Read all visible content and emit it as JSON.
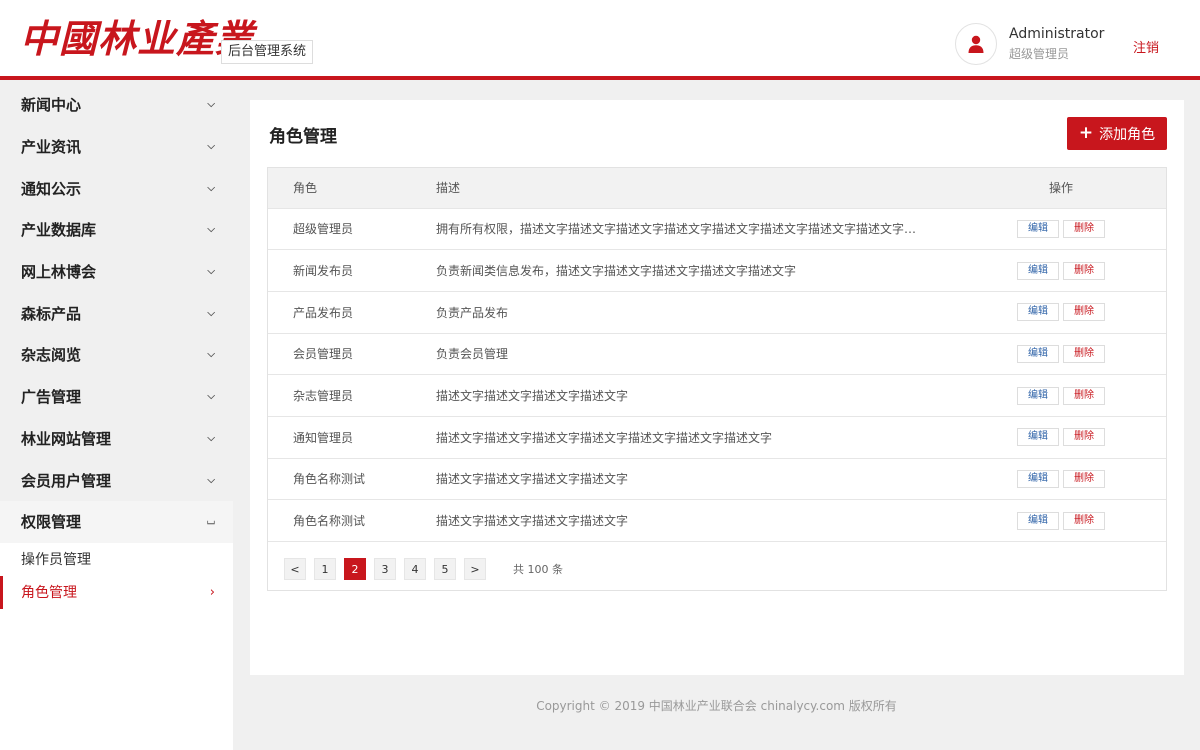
{
  "header": {
    "logo_text": "中國林业產業",
    "system_name": "后台管理系统",
    "user": {
      "name": "Administrator",
      "role": "超级管理员"
    },
    "logout_label": "注销"
  },
  "sidebar": {
    "items": [
      {
        "label": "新闻中心",
        "icon": "chevron-down-icon"
      },
      {
        "label": "产业资讯",
        "icon": "chevron-down-icon"
      },
      {
        "label": "通知公示",
        "icon": "chevron-down-icon"
      },
      {
        "label": "产业数据库",
        "icon": "chevron-down-icon"
      },
      {
        "label": "网上林博会",
        "icon": "chevron-down-icon"
      },
      {
        "label": "森标产品",
        "icon": "chevron-down-icon"
      },
      {
        "label": "杂志阅览",
        "icon": "chevron-down-icon"
      },
      {
        "label": "广告管理",
        "icon": "chevron-down-icon"
      },
      {
        "label": "林业网站管理",
        "icon": "chevron-down-icon"
      },
      {
        "label": "会员用户管理",
        "icon": "chevron-down-icon"
      },
      {
        "label": "权限管理",
        "icon": "chevron-up-icon"
      }
    ],
    "sub_items": [
      {
        "label": "操作员管理"
      },
      {
        "label": "角色管理",
        "active": true
      }
    ]
  },
  "main": {
    "title": "角色管理",
    "add_button": "添加角色",
    "table": {
      "headers": {
        "role": "角色",
        "desc": "描述",
        "ops": "操作"
      },
      "edit_label": "编辑",
      "delete_label": "删除",
      "rows": [
        {
          "role": "超级管理员",
          "desc": "拥有所有权限，描述文字描述文字描述文字描述文字描述文字描述文字描述文字描述文字…"
        },
        {
          "role": "新闻发布员",
          "desc": "负责新闻类信息发布，描述文字描述文字描述文字描述文字描述文字"
        },
        {
          "role": "产品发布员",
          "desc": "负责产品发布"
        },
        {
          "role": "会员管理员",
          "desc": "负责会员管理"
        },
        {
          "role": "杂志管理员",
          "desc": "描述文字描述文字描述文字描述文字"
        },
        {
          "role": "通知管理员",
          "desc": "描述文字描述文字描述文字描述文字描述文字描述文字描述文字"
        },
        {
          "role": "角色名称测试",
          "desc": "描述文字描述文字描述文字描述文字"
        },
        {
          "role": "角色名称测试",
          "desc": "描述文字描述文字描述文字描述文字"
        }
      ]
    },
    "pagination": {
      "prev": "<",
      "pages": [
        "1",
        "2",
        "3",
        "4",
        "5"
      ],
      "current": "2",
      "next": ">",
      "total": "共 100 条"
    }
  },
  "footer": {
    "copyright": "Copyright © 2019 中国林业产业联合会 chinalycy.com 版权所有"
  },
  "colors": {
    "brand_red": "#c8161d",
    "edit_blue": "#2f63a8"
  }
}
